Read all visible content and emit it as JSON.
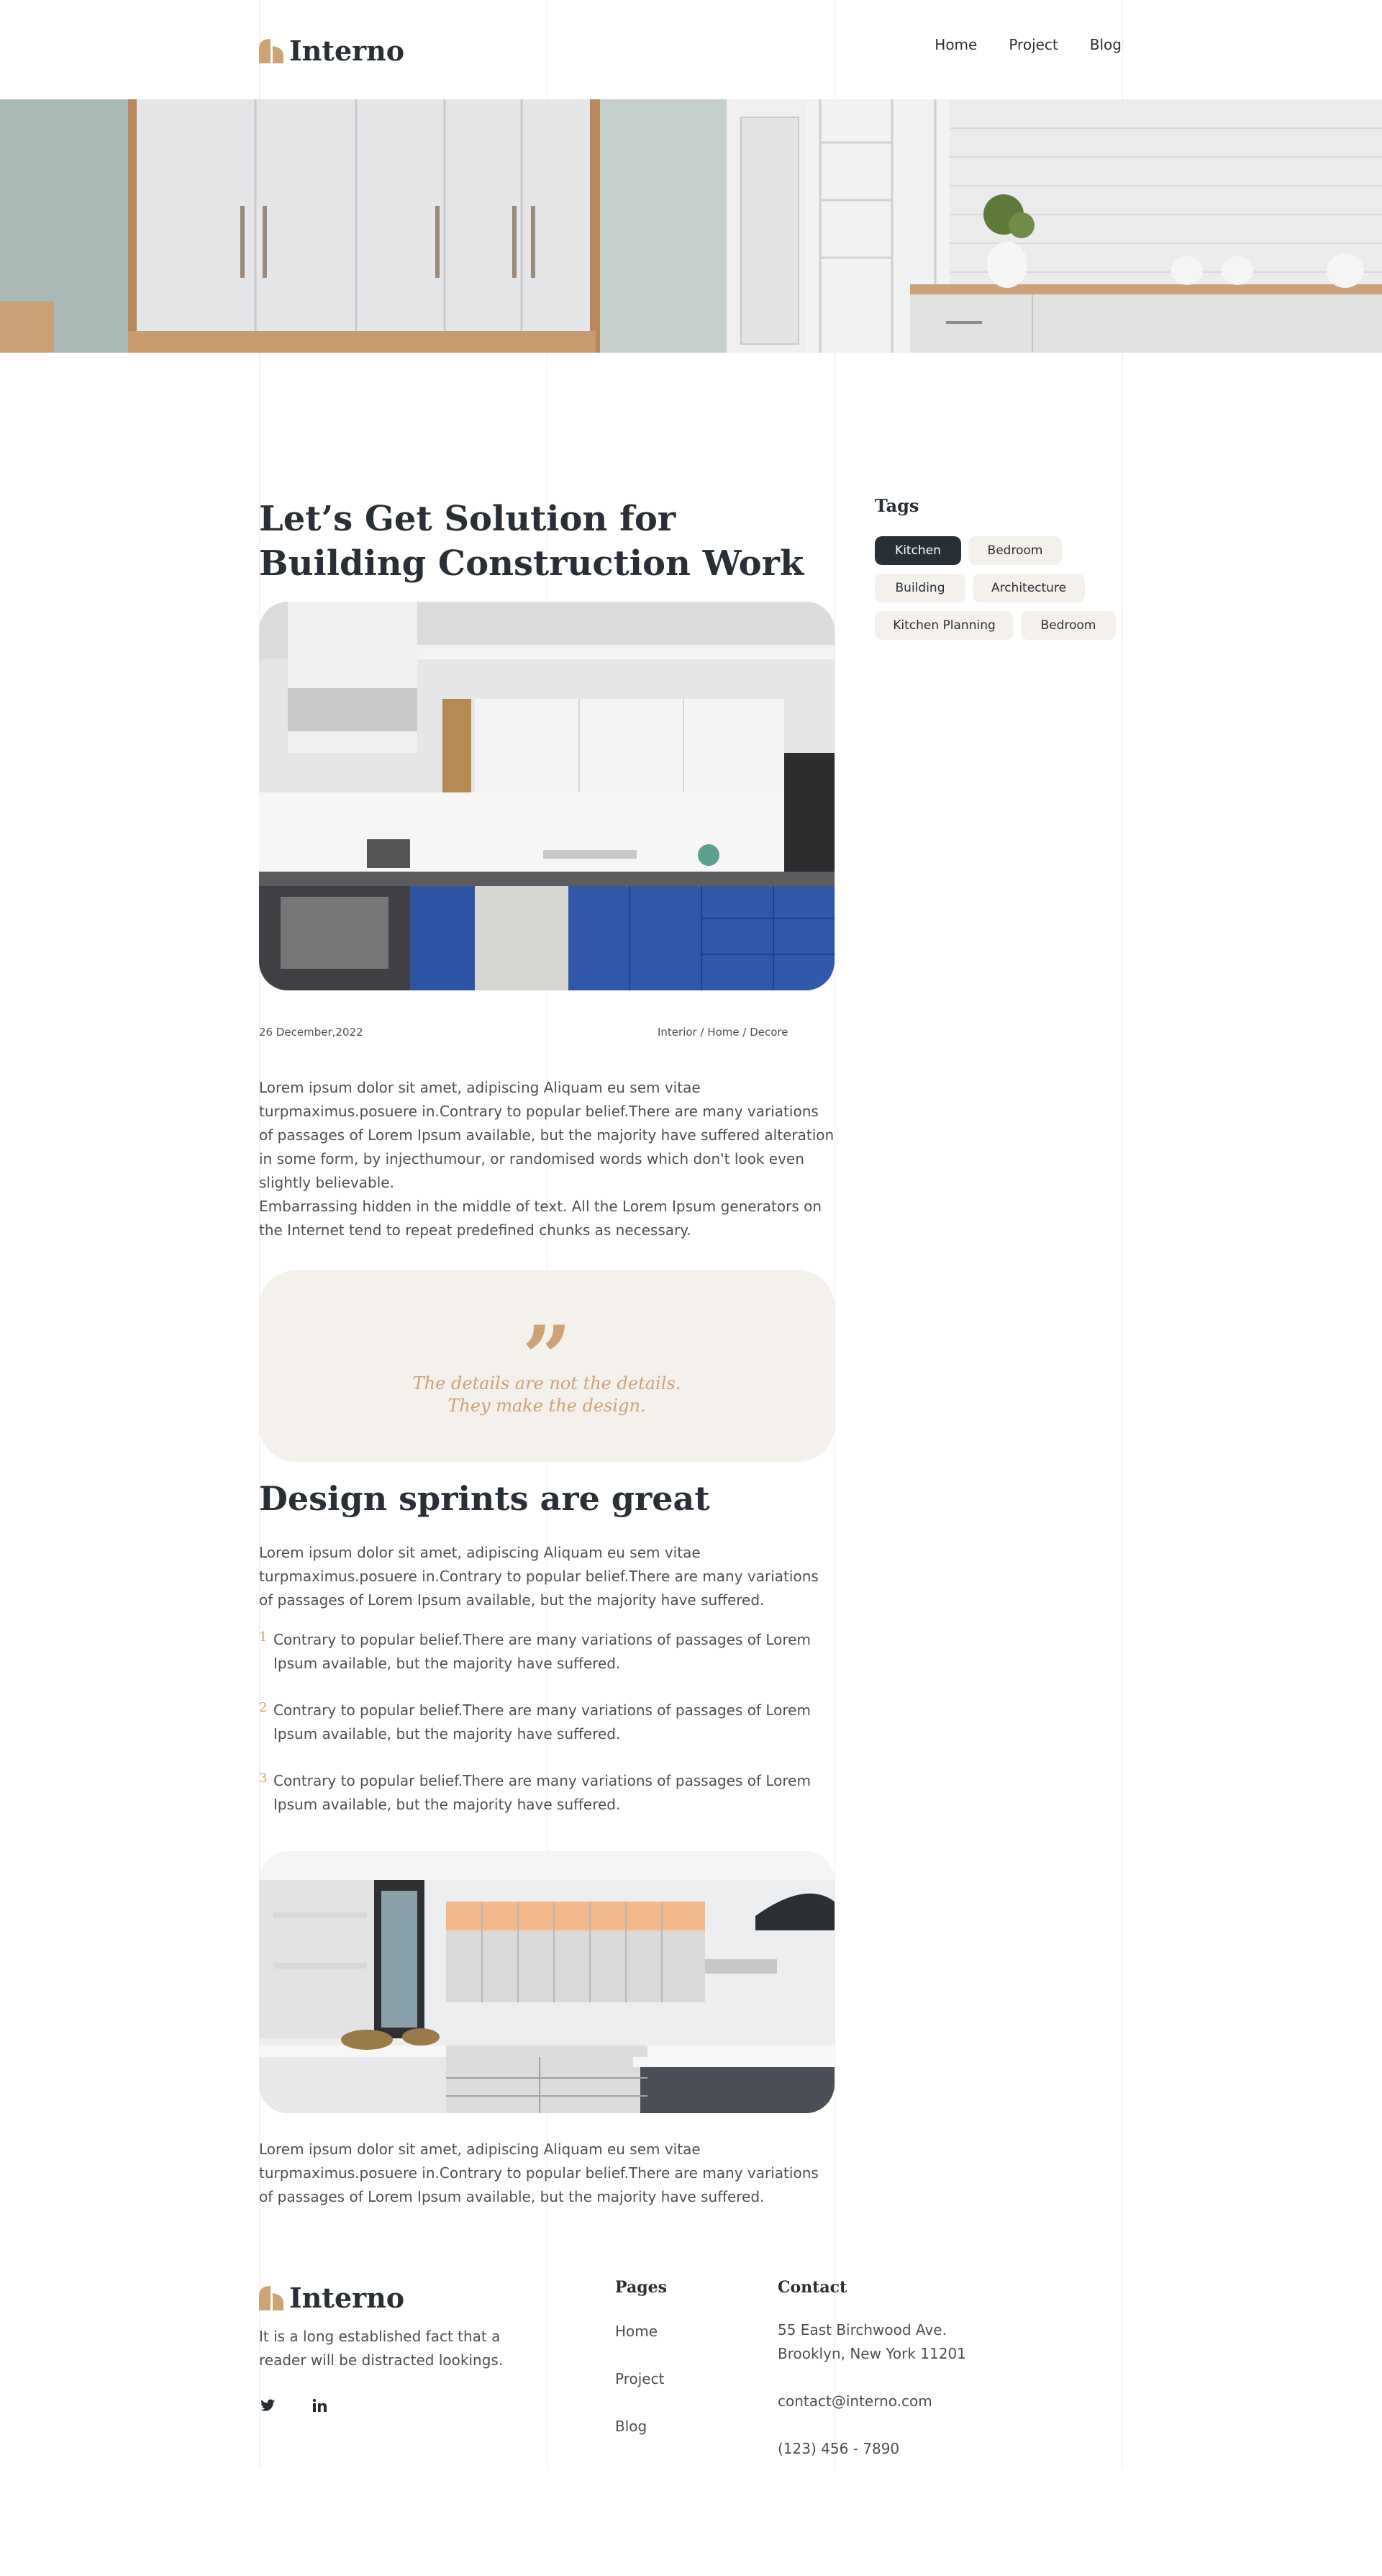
{
  "header": {
    "logo_text": "Interno",
    "nav": [
      {
        "label": "Home"
      },
      {
        "label": "Project"
      },
      {
        "label": "Blog"
      }
    ]
  },
  "article": {
    "title": "Let’s Get Solution for Building Construction Work",
    "date": "26 December,2022",
    "categories": "Interior / Home / Decore",
    "intro_paragraph_1": "Lorem ipsum dolor sit amet, adipiscing Aliquam eu sem vitae turpmaximus.posuere in.Contrary to popular belief.There are many variations of passages of Lorem Ipsum available, but the majority have suffered alteration in some form, by injecthumour, or randomised words which don't look even slightly believable.",
    "intro_paragraph_2": "Embarrassing hidden in the middle of text. All the Lorem Ipsum generators on the Internet tend to repeat predefined chunks as necessary.",
    "quote_mark": "”",
    "quote_line_1": "The details are not the details.",
    "quote_line_2": "They make the design.",
    "section_title": "Design sprints are great",
    "section_paragraph": "Lorem ipsum dolor sit amet, adipiscing Aliquam eu sem vitae turpmaximus.posuere in.Contrary to popular belief.There are many variations of passages of Lorem Ipsum available, but the majority have suffered.",
    "list": [
      {
        "num": "1",
        "text": "Contrary to popular belief.There are many variations of passages of Lorem Ipsum available, but the majority have suffered."
      },
      {
        "num": "2",
        "text": "Contrary to popular belief.There are many variations of passages of Lorem Ipsum available, but the majority have suffered."
      },
      {
        "num": "3",
        "text": "Contrary to popular belief.There are many variations of passages of Lorem Ipsum available, but the majority have suffered."
      }
    ],
    "closing_paragraph": "Lorem ipsum dolor sit amet, adipiscing Aliquam eu sem vitae turpmaximus.posuere in.Contrary to popular belief.There are many variations of passages of Lorem Ipsum available, but the majority have suffered."
  },
  "sidebar": {
    "tags_title": "Tags",
    "tags": [
      {
        "label": "Kitchen",
        "active": true
      },
      {
        "label": "Bedroom",
        "active": false
      },
      {
        "label": "Building",
        "active": false
      },
      {
        "label": "Architecture",
        "active": false
      },
      {
        "label": "Kitchen Planning",
        "active": false
      },
      {
        "label": "Bedroom",
        "active": false
      }
    ]
  },
  "footer": {
    "logo_text": "Interno",
    "description": "It is a long established fact that a reader will be distracted lookings.",
    "social_icons": [
      "twitter-icon",
      "linkedin-icon"
    ],
    "pages_title": "Pages",
    "pages": [
      {
        "label": "Home"
      },
      {
        "label": "Project"
      },
      {
        "label": "Blog"
      }
    ],
    "contact_title": "Contact",
    "address_line_1": "55 East Birchwood Ave.",
    "address_line_2": "Brooklyn, New York 11201",
    "email": "contact@interno.com",
    "phone": "(123) 456 - 7890"
  },
  "colors": {
    "accent": "#cda274",
    "dark": "#292f36",
    "beige": "#f4f0ec",
    "text": "#4d5053"
  }
}
